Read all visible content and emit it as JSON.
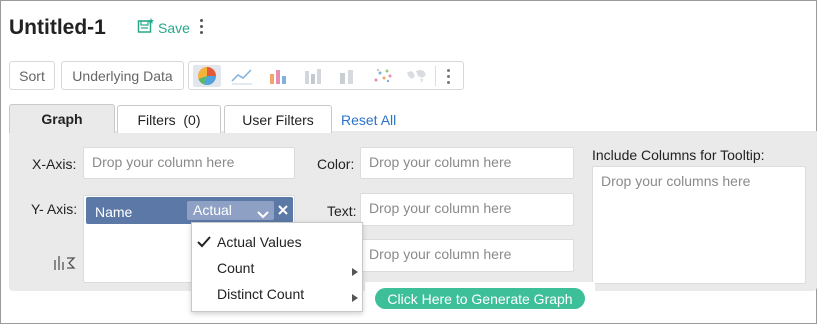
{
  "header": {
    "title": "Untitled-1",
    "save_label": "Save"
  },
  "toolbar": {
    "sort_label": "Sort",
    "underlying_label": "Underlying Data",
    "chart_types": [
      "pie-chart-icon",
      "line-chart-icon",
      "bar-chart-icon",
      "stacked-bar-chart-icon",
      "column-chart-icon",
      "scatter-chart-icon",
      "map-chart-icon"
    ]
  },
  "tabs": {
    "graph": "Graph",
    "filters": "Filters  (0)",
    "user_filters": "User Filters",
    "reset_all": "Reset All"
  },
  "form": {
    "x_axis_label": "X-Axis:",
    "y_axis_label": "Y- Axis:",
    "color_label": "Color:",
    "text_label": "Text:",
    "tooltip_label": "Include Columns for Tooltip:",
    "drop_placeholder": "Drop your column here",
    "tooltip_placeholder": "Drop your columns here"
  },
  "y_axis_field": {
    "name": "Name",
    "aggregate": "Actual"
  },
  "aggregate_menu": {
    "items": [
      {
        "label": "Actual Values",
        "checked": true,
        "submenu": false
      },
      {
        "label": "Count",
        "checked": false,
        "submenu": true
      },
      {
        "label": "Distinct Count",
        "checked": false,
        "submenu": true
      }
    ]
  },
  "generate_label": "Click Here to Generate Graph",
  "colors": {
    "accent": "#26a98a",
    "pill": "#5c78a6",
    "link": "#2a73c9",
    "generate": "#3dbf9a"
  }
}
